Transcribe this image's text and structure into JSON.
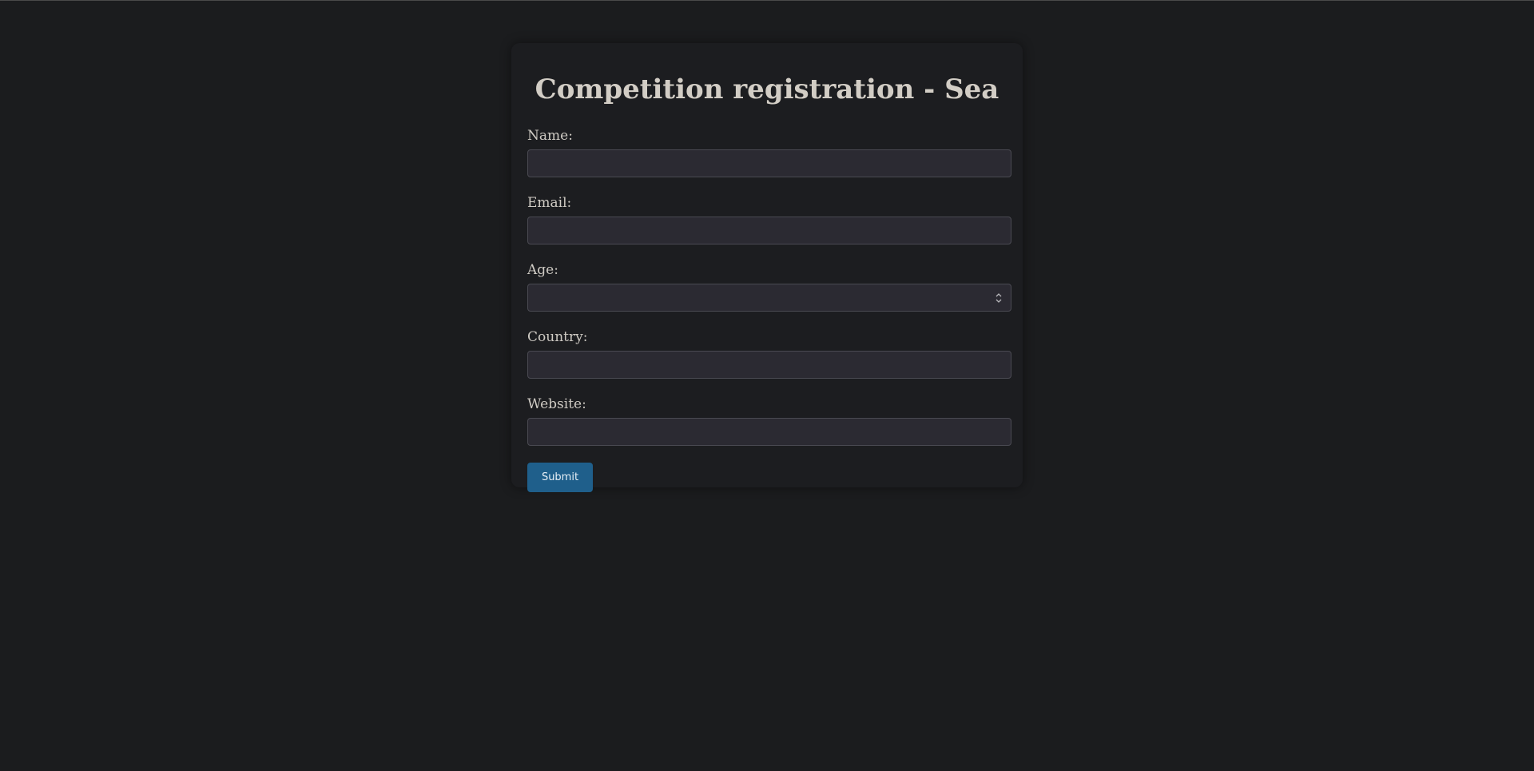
{
  "form": {
    "title": "Competition registration - Sea",
    "fields": [
      {
        "label": "Name:",
        "value": "",
        "placeholder": ""
      },
      {
        "label": "Email:",
        "value": "",
        "placeholder": ""
      },
      {
        "label": "Age:",
        "value": "",
        "placeholder": ""
      },
      {
        "label": "Country:",
        "value": "",
        "placeholder": ""
      },
      {
        "label": "Website:",
        "value": "",
        "placeholder": ""
      }
    ],
    "submit_label": "Submit"
  },
  "colors": {
    "background": "#1b1c1e",
    "card": "#1c1d20",
    "input_bg": "#2b2a32",
    "button": "#1f5f8b",
    "text": "#cfcbc4"
  },
  "icons": {
    "age_spinner": "spinner-updown-icon"
  }
}
